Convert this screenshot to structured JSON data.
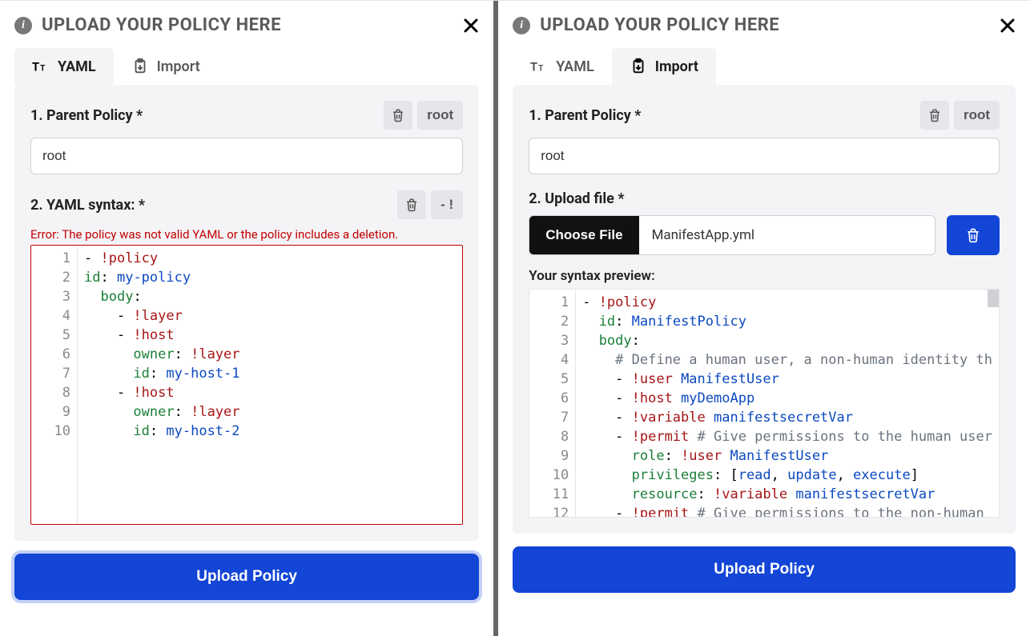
{
  "left": {
    "header": {
      "title": "UPLOAD YOUR POLICY HERE",
      "info_glyph": "i"
    },
    "tabs": {
      "yaml": "YAML",
      "import": "Import",
      "active": "yaml"
    },
    "parent": {
      "label": "1. Parent Policy *",
      "root_btn": "root",
      "value": "root"
    },
    "section2": {
      "label": "2. YAML syntax: *",
      "dash_btn": "- !",
      "error": "Error: The policy was not valid YAML or the policy includes a deletion.",
      "lines": [
        "- !policy",
        "id: my-policy",
        "  body:",
        "    - !layer",
        "    - !host",
        "      owner: !layer",
        "      id: my-host-1",
        "    - !host",
        "      owner: !layer",
        "      id: my-host-2"
      ]
    },
    "upload_btn": "Upload Policy"
  },
  "right": {
    "header": {
      "title": "UPLOAD YOUR POLICY HERE",
      "info_glyph": "i"
    },
    "tabs": {
      "yaml": "YAML",
      "import": "Import",
      "active": "import"
    },
    "parent": {
      "label": "1. Parent Policy *",
      "root_btn": "root",
      "value": "root"
    },
    "section2": {
      "label": "2. Upload file *",
      "choose_btn": "Choose File",
      "file_name": "ManifestApp.yml",
      "preview_label": "Your syntax preview:",
      "lines": [
        "- !policy",
        "  id: ManifestPolicy",
        "  body:",
        "    # Define a human user, a non-human identity th",
        "    - !user ManifestUser",
        "    - !host myDemoApp",
        "    - !variable manifestsecretVar",
        "    - !permit # Give permissions to the human user",
        "      role: !user ManifestUser",
        "      privileges: [read, update, execute]",
        "      resource: !variable manifestsecretVar",
        "    - !permit # Give permissions to the non-human"
      ]
    },
    "upload_btn": "Upload Policy"
  }
}
